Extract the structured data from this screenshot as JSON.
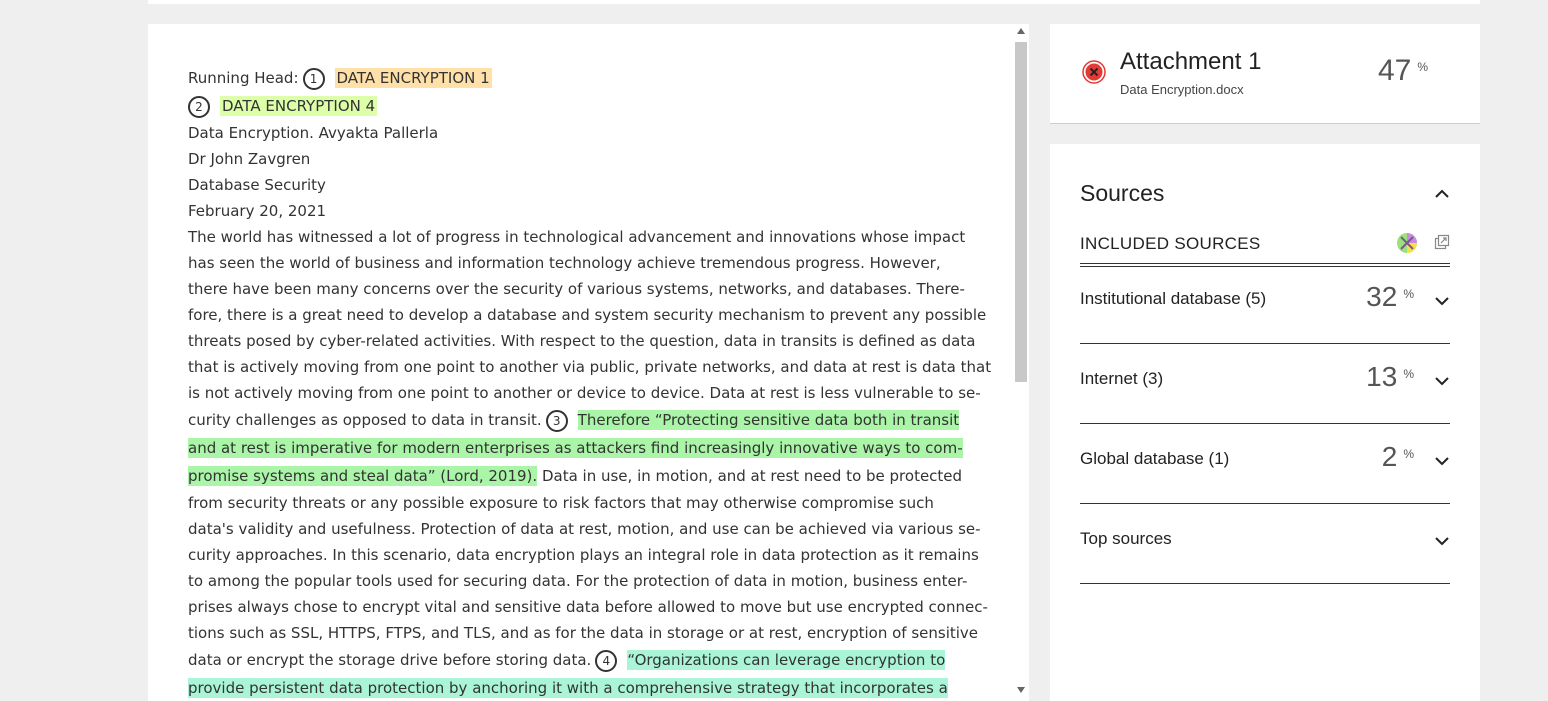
{
  "document": {
    "lines": [
      {
        "type": "head",
        "label": "Running Head:",
        "num": "1",
        "hl": "DATA ENCRYPTION 1"
      },
      {
        "type": "numhl",
        "num": "2",
        "hl": "DATA ENCRYPTION 4"
      },
      {
        "type": "text",
        "text": "Data Encryption. Avyakta Pallerla"
      },
      {
        "type": "text",
        "text": "Dr John Zavgren"
      },
      {
        "type": "text",
        "text": "Database Security"
      },
      {
        "type": "text",
        "text": "February 20, 2021"
      },
      {
        "type": "text",
        "text": "The world has witnessed a lot of progress in technological advancement and innovations whose impact"
      },
      {
        "type": "text",
        "text": "has seen the world of business and information technology achieve tremendous progress. However,"
      },
      {
        "type": "text",
        "text": "there have been many concerns over the security of various systems, networks, and databases. There-"
      },
      {
        "type": "text",
        "text": "fore, there is a great need to develop a database and system security mechanism to prevent any possible"
      },
      {
        "type": "text",
        "text": "threats posed by cyber-related activities. With respect to the question, data in transits is defined as data"
      },
      {
        "type": "text",
        "text": "that is actively moving from one point to another via public, private networks, and data at rest is data that"
      },
      {
        "type": "text",
        "text": "is not actively moving from one point to another or device to device. Data at rest is less vulnerable to se-"
      },
      {
        "type": "mixed",
        "pre": "curity challenges as opposed to data in transit.",
        "num": "3",
        "hl": "Therefore “Protecting sensitive data both in transit",
        "hlclass": "hl-green"
      },
      {
        "type": "full",
        "hl": "and at rest is imperative for modern enterprises as attackers find increasingly innovative ways to com-",
        "hlclass": "hl-green"
      },
      {
        "type": "hlpost",
        "hl": "promise systems and steal data” (Lord, 2019).",
        "post": " Data in use, in motion, and at rest need to be protected",
        "hlclass": "hl-green"
      },
      {
        "type": "text",
        "text": "from security threats or any possible exposure to risk factors that may otherwise compromise such"
      },
      {
        "type": "text",
        "text": "data's validity and usefulness. Protection of data at rest, motion, and use can be achieved via various se-"
      },
      {
        "type": "text",
        "text": "curity approaches. In this scenario, data encryption plays an integral role in data protection as it remains"
      },
      {
        "type": "text",
        "text": "to among the popular tools used for securing data. For the protection of data in motion, business enter-"
      },
      {
        "type": "text",
        "text": "prises always chose to encrypt vital and sensitive data before allowed to move but use encrypted connec-"
      },
      {
        "type": "text",
        "text": "tions such as SSL, HTTPS, FTPS, and TLS, and as for the data in storage or at rest, encryption of sensitive"
      },
      {
        "type": "mixed",
        "pre": "data or encrypt the storage drive before storing data.",
        "num": "4",
        "hl": "“Organizations can leverage encryption to",
        "hlclass": "hl-teal"
      },
      {
        "type": "full",
        "hl": "provide persistent data protection by anchoring it with a comprehensive strategy that incorporates a",
        "hlclass": "hl-teal"
      }
    ]
  },
  "attachment": {
    "title": "Attachment 1",
    "file": "Data Encryption.docx",
    "percent": "47",
    "pct_sign": "%"
  },
  "sources": {
    "title": "Sources",
    "included_label": "INCLUDED SOURCES",
    "rows": [
      {
        "name": "Institutional database (5)",
        "percent": "32",
        "pct_sign": "%"
      },
      {
        "name": "Internet (3)",
        "percent": "13",
        "pct_sign": "%"
      },
      {
        "name": "Global database (1)",
        "percent": "2",
        "pct_sign": "%"
      },
      {
        "name": "Top sources",
        "percent": "",
        "pct_sign": ""
      }
    ]
  },
  "colors": {
    "error": "#e53935",
    "orange_hl": "#ffe0a8",
    "lime_hl": "#ddffaa",
    "green_hl": "#abf5a8",
    "teal_hl": "#aaf5d8"
  }
}
